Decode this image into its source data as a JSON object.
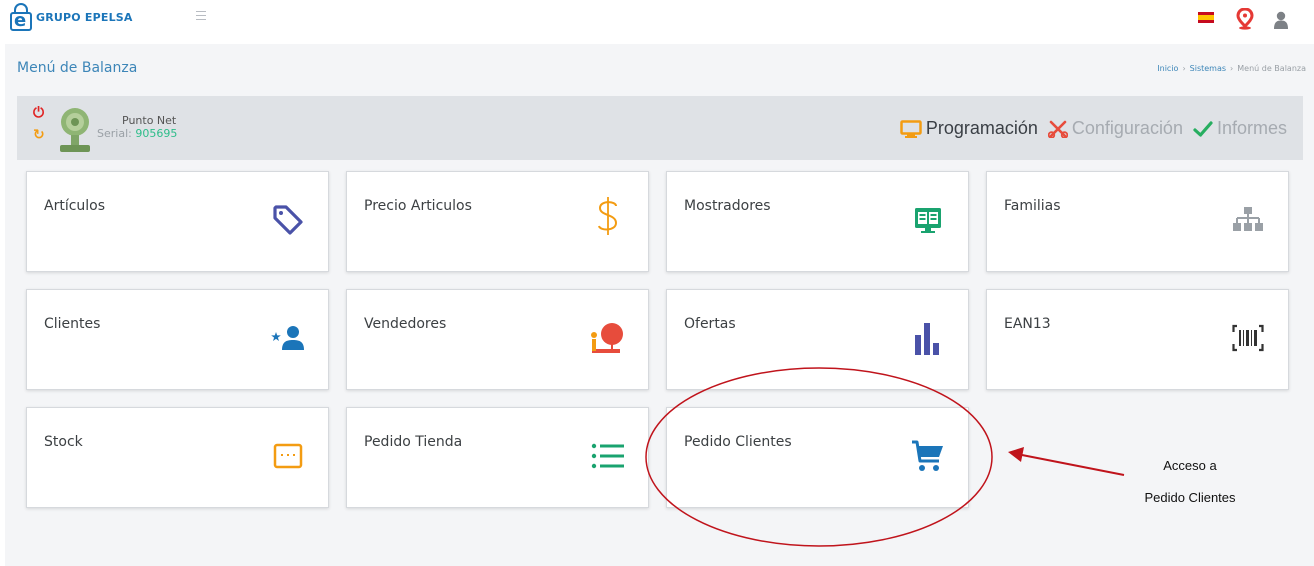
{
  "header": {
    "brand": "GRUPO EPELSA",
    "menu_icon": "hamburger-icon",
    "language_icon": "spain-flag-icon",
    "location_icon": "map-pin-icon",
    "user_icon": "user-icon"
  },
  "page": {
    "title": "Menú de Balanza",
    "breadcrumb": [
      "Inicio",
      "Sistemas",
      "Menú de Balanza"
    ]
  },
  "device": {
    "name": "Punto Net",
    "serial_label": "Serial:",
    "serial_value": "905695",
    "power_icon": "power-icon",
    "refresh_icon": "refresh-icon"
  },
  "modes": [
    {
      "label": "Programación",
      "icon": "monitor-icon",
      "color": "#f39c12",
      "active": true
    },
    {
      "label": "Configuración",
      "icon": "tools-icon",
      "color": "#e74c3c",
      "active": false
    },
    {
      "label": "Informes",
      "icon": "check-icon",
      "color": "#27ae60",
      "active": false
    }
  ],
  "cards": [
    {
      "label": "Artículos",
      "icon": "tag-icon",
      "color": "#4a52a8"
    },
    {
      "label": "Precio Articulos",
      "icon": "dollar-icon",
      "color": "#f39c12"
    },
    {
      "label": "Mostradores",
      "icon": "display-icon",
      "color": "#1aa36f"
    },
    {
      "label": "Familias",
      "icon": "sitemap-icon",
      "color": "#9aa0a6"
    },
    {
      "label": "Clientes",
      "icon": "client-star-icon",
      "color": "#1b75b9"
    },
    {
      "label": "Vendedores",
      "icon": "seller-icon",
      "color": "#e74c3c"
    },
    {
      "label": "Ofertas",
      "icon": "bar-chart-icon",
      "color": "#4a52a8"
    },
    {
      "label": "EAN13",
      "icon": "barcode-icon",
      "color": "#333333"
    },
    {
      "label": "Stock",
      "icon": "stock-box-icon",
      "color": "#f39c12"
    },
    {
      "label": "Pedido Tienda",
      "icon": "list-icon",
      "color": "#1aa36f"
    },
    {
      "label": "Pedido Clientes",
      "icon": "cart-icon",
      "color": "#1b75b9"
    }
  ],
  "annotation": {
    "line1": "Acceso a",
    "line2": "Pedido Clientes",
    "color": "#c0141c"
  }
}
